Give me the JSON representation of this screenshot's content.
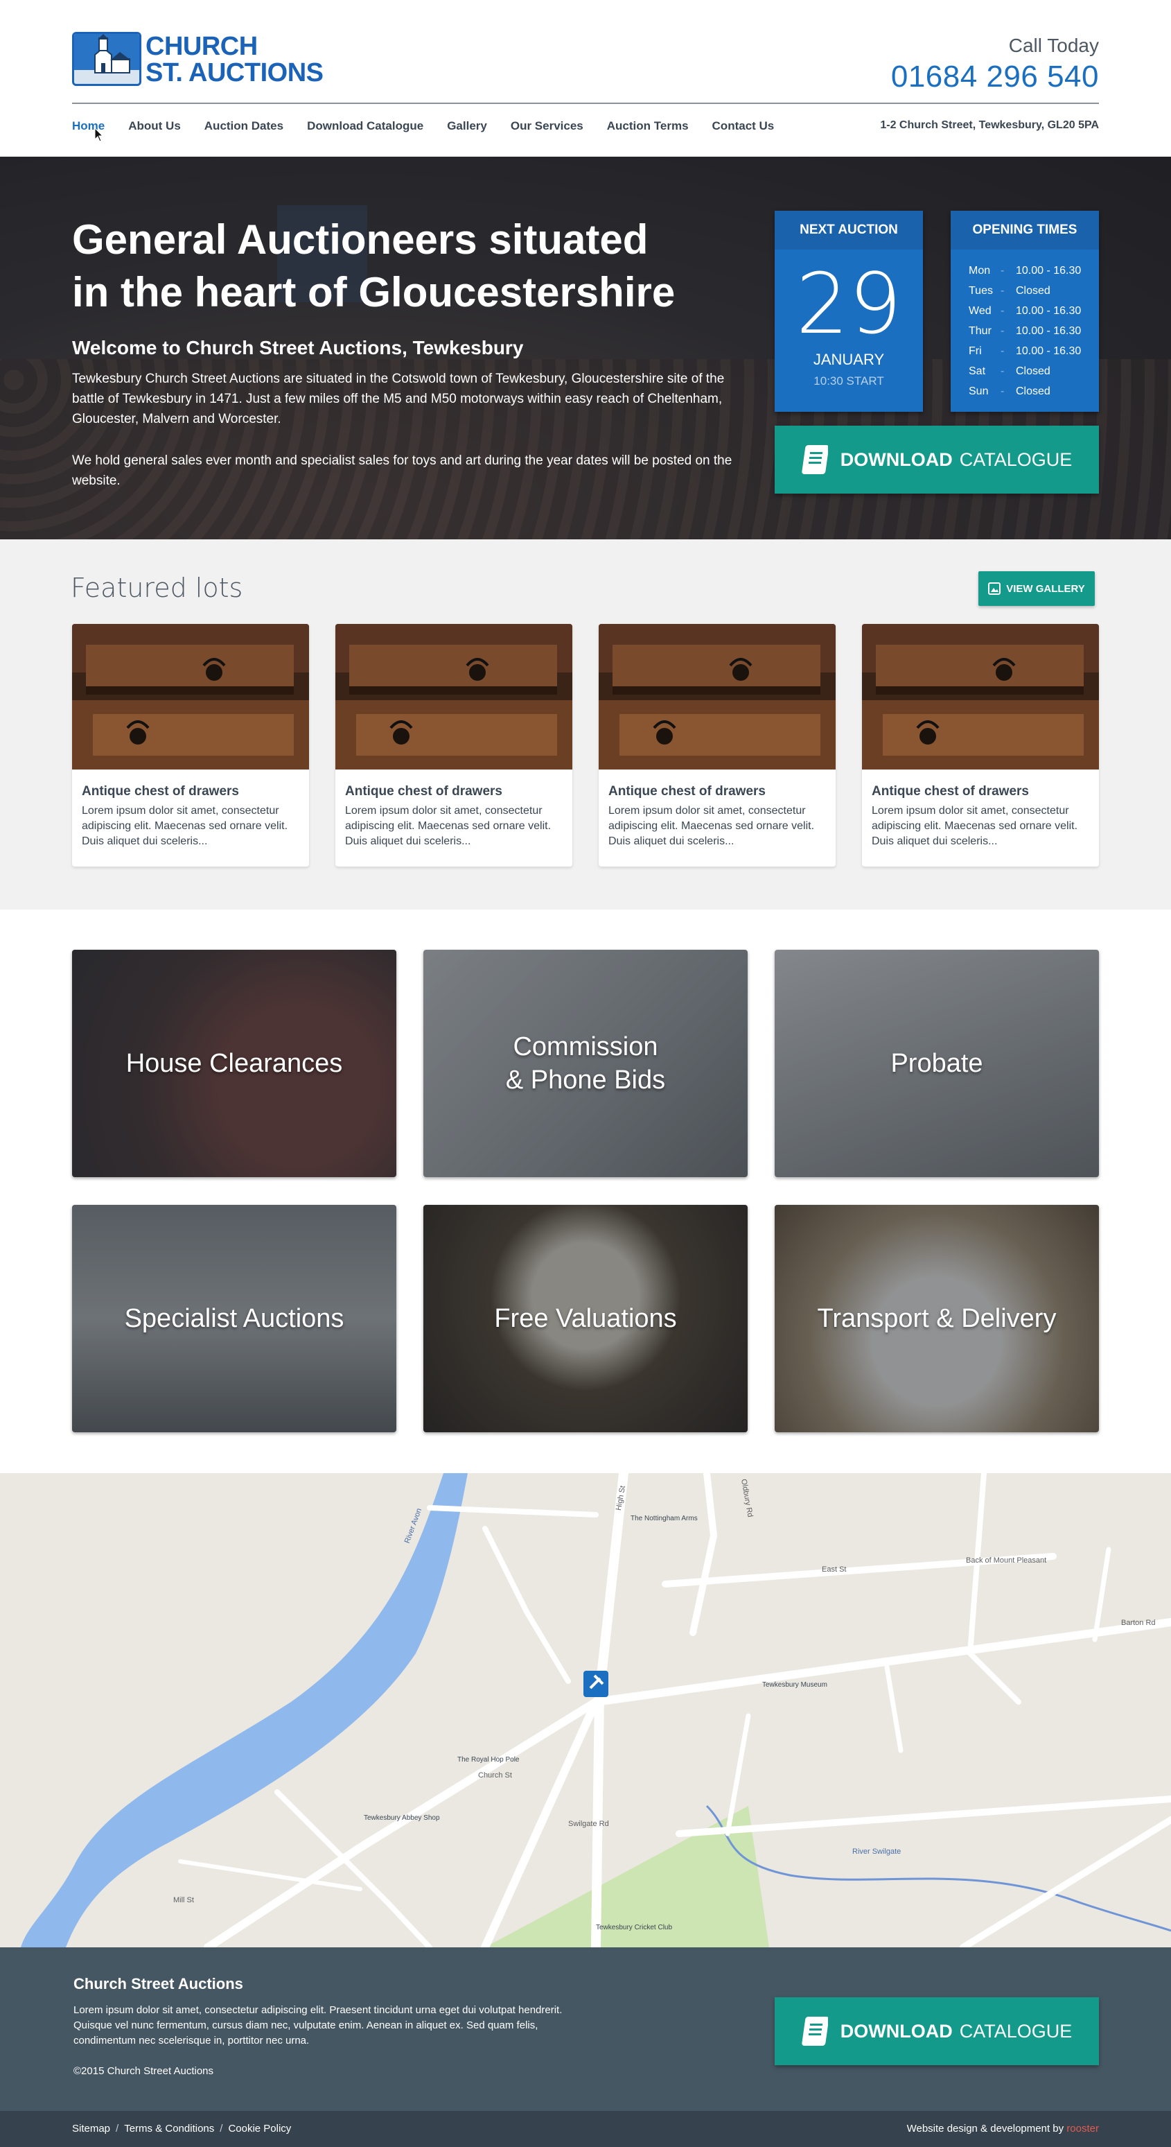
{
  "header": {
    "logo_line1": "CHURCH",
    "logo_line2": "ST. AUCTIONS",
    "call_label": "Call Today",
    "phone": "01684 296 540",
    "address": "1-2 Church Street, Tewkesbury, GL20 5PA",
    "nav": [
      "Home",
      "About Us",
      "Auction Dates",
      "Download Catalogue",
      "Gallery",
      "Our Services",
      "Auction Terms",
      "Contact Us"
    ]
  },
  "hero": {
    "title_line1": "General Auctioneers situated",
    "title_line2": "in the heart of Gloucestershire",
    "subtitle": "Welcome to Church Street Auctions, Tewkesbury",
    "para1": "Tewkesbury Church Street Auctions are situated in the Cotswold town of Tewkesbury, Gloucestershire site of the battle of Tewkesbury in 1471. Just a few miles off the M5 and M50 motorways within easy reach of Cheltenham, Gloucester, Malvern and Worcester.",
    "para2": "We hold general sales ever month and specialist sales for toys and art during the year dates will be posted on the website.",
    "next_auction": {
      "heading": "NEXT AUCTION",
      "day": "29",
      "month": "JANUARY",
      "start": "10:30 START"
    },
    "opening": {
      "heading": "OPENING TIMES",
      "separator": "-",
      "rows": [
        {
          "day": "Mon",
          "time": "10.00 - 16.30"
        },
        {
          "day": "Tues",
          "time": "Closed"
        },
        {
          "day": "Wed",
          "time": "10.00 - 16.30"
        },
        {
          "day": "Thur",
          "time": "10.00 - 16.30"
        },
        {
          "day": "Fri",
          "time": "10.00 - 16.30"
        },
        {
          "day": "Sat",
          "time": "Closed"
        },
        {
          "day": "Sun",
          "time": "Closed"
        }
      ]
    },
    "download_bold": "DOWNLOAD",
    "download_rest": "CATALOGUE"
  },
  "featured": {
    "title": "Featured lots",
    "gallery_label": "VIEW GALLERY",
    "lots": [
      {
        "title": "Antique chest of drawers",
        "desc": "Lorem ipsum dolor sit amet, consectetur adipiscing elit. Maecenas sed ornare velit. Duis aliquet dui sceleris..."
      },
      {
        "title": "Antique chest of drawers",
        "desc": "Lorem ipsum dolor sit amet, consectetur adipiscing elit. Maecenas sed ornare velit. Duis aliquet dui sceleris..."
      },
      {
        "title": "Antique chest of drawers",
        "desc": "Lorem ipsum dolor sit amet, consectetur adipiscing elit. Maecenas sed ornare velit. Duis aliquet dui sceleris..."
      },
      {
        "title": "Antique chest of drawers",
        "desc": "Lorem ipsum dolor sit amet, consectetur adipiscing elit. Maecenas sed ornare velit. Duis aliquet dui sceleris..."
      }
    ]
  },
  "services": [
    {
      "line1": "House Clearances",
      "line2": ""
    },
    {
      "line1": "Commission",
      "line2": "& Phone Bids"
    },
    {
      "line1": "Probate",
      "line2": ""
    },
    {
      "line1": "Specialist Auctions",
      "line2": ""
    },
    {
      "line1": "Free Valuations",
      "line2": ""
    },
    {
      "line1": "Transport & Delivery",
      "line2": ""
    }
  ],
  "map": {
    "labels": [
      "River Avon",
      "Barton Rd",
      "East St",
      "Back of Mount Pleasant",
      "Church St",
      "Swilgate Rd",
      "River Swilgate",
      "Tewkesbury Abbey Shop",
      "Tewkesbury Museum",
      "The Royal Hop Pole",
      "The Nottingham Arms",
      "Tewkesbury Cricket Club",
      "Oldbury Rd",
      "High St",
      "Mill St"
    ]
  },
  "footer": {
    "title": "Church Street Auctions",
    "text": "Lorem ipsum dolor sit amet, consectetur adipiscing elit. Praesent tincidunt urna eget dui volutpat hendrerit. Quisque vel nunc fermentum, cursus diam nec, vulputate enim. Aenean in aliquet ex. Sed quam felis, condimentum nec scelerisque in, porttitor nec urna.",
    "copyright": "©2015 Church Street Auctions",
    "download_bold": "DOWNLOAD",
    "download_rest": "CATALOGUE"
  },
  "bottom": {
    "links": [
      "Sitemap",
      "Terms & Conditions",
      "Cookie Policy"
    ],
    "link_separator": "/",
    "credit_text": "Website design & development by",
    "credit_brand": "rooster"
  }
}
